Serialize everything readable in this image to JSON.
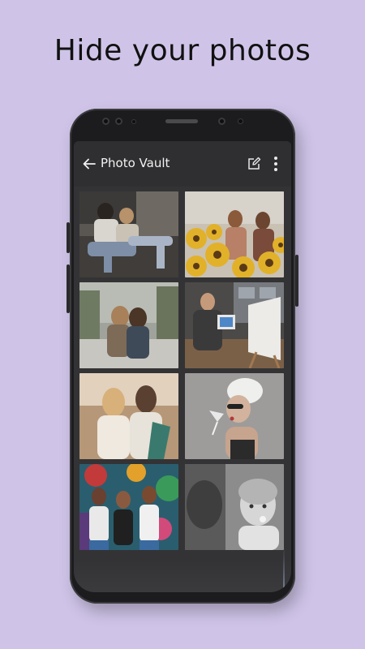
{
  "promo": {
    "headline": "Hide your photos"
  },
  "app": {
    "title": "Photo Vault",
    "icons": {
      "back": "arrow-left-icon",
      "edit": "edit-icon",
      "more": "more-vertical-icon"
    }
  },
  "photos": [
    {
      "name": "friends-couch-photo"
    },
    {
      "name": "sunflowers-girls-photo"
    },
    {
      "name": "hugging-friends-photo"
    },
    {
      "name": "painter-easel-photo"
    },
    {
      "name": "beach-friends-photo"
    },
    {
      "name": "towel-drink-photo"
    },
    {
      "name": "mural-girls-photo"
    },
    {
      "name": "child-bw-photo"
    }
  ],
  "colors": {
    "background": "#cfc4e8",
    "phone": "#1c1c1e",
    "screen": "#333335",
    "appbar": "#2f2f31"
  }
}
